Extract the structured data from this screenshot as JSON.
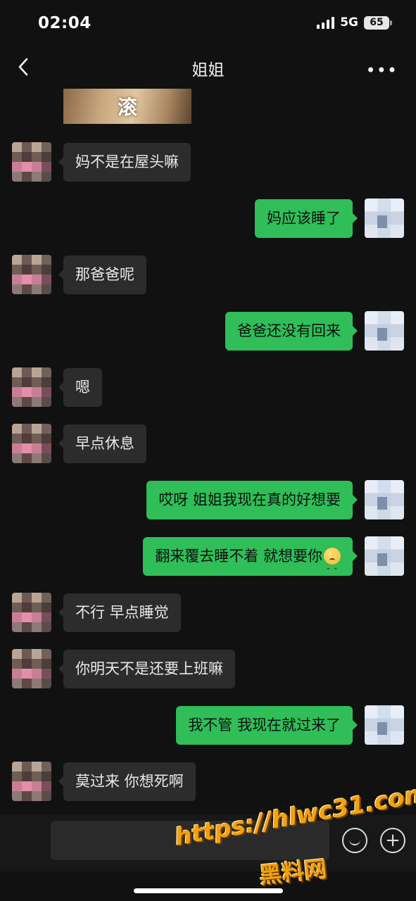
{
  "status_bar": {
    "time": "02:04",
    "network": "5G",
    "battery": "65"
  },
  "nav": {
    "title": "姐姐"
  },
  "sticker": {
    "text": "滚"
  },
  "messages": [
    {
      "side": "left",
      "text": "妈不是在屋头嘛"
    },
    {
      "side": "right",
      "text": "妈应该睡了"
    },
    {
      "side": "left",
      "text": "那爸爸呢"
    },
    {
      "side": "right",
      "text": "爸爸还没有回来"
    },
    {
      "side": "left",
      "text": "嗯"
    },
    {
      "side": "left",
      "text": "早点休息"
    },
    {
      "side": "right",
      "text": "哎呀 姐姐我现在真的好想要"
    },
    {
      "side": "right",
      "text": "翻来覆去睡不着 就想要你"
    },
    {
      "side": "left",
      "text": "不行 早点睡觉"
    },
    {
      "side": "left",
      "text": "你明天不是还要上班嘛"
    },
    {
      "side": "right",
      "text": "我不管 我现在就过来了"
    },
    {
      "side": "left",
      "text": "莫过来 你想死啊"
    }
  ],
  "watermark": {
    "url": "https://hlwc31.com",
    "name": "黑料网"
  },
  "colors": {
    "background": "#111111",
    "bubble_left": "#2c2c2c",
    "bubble_right": "#2fbe58",
    "watermark": "#f2a20e"
  }
}
